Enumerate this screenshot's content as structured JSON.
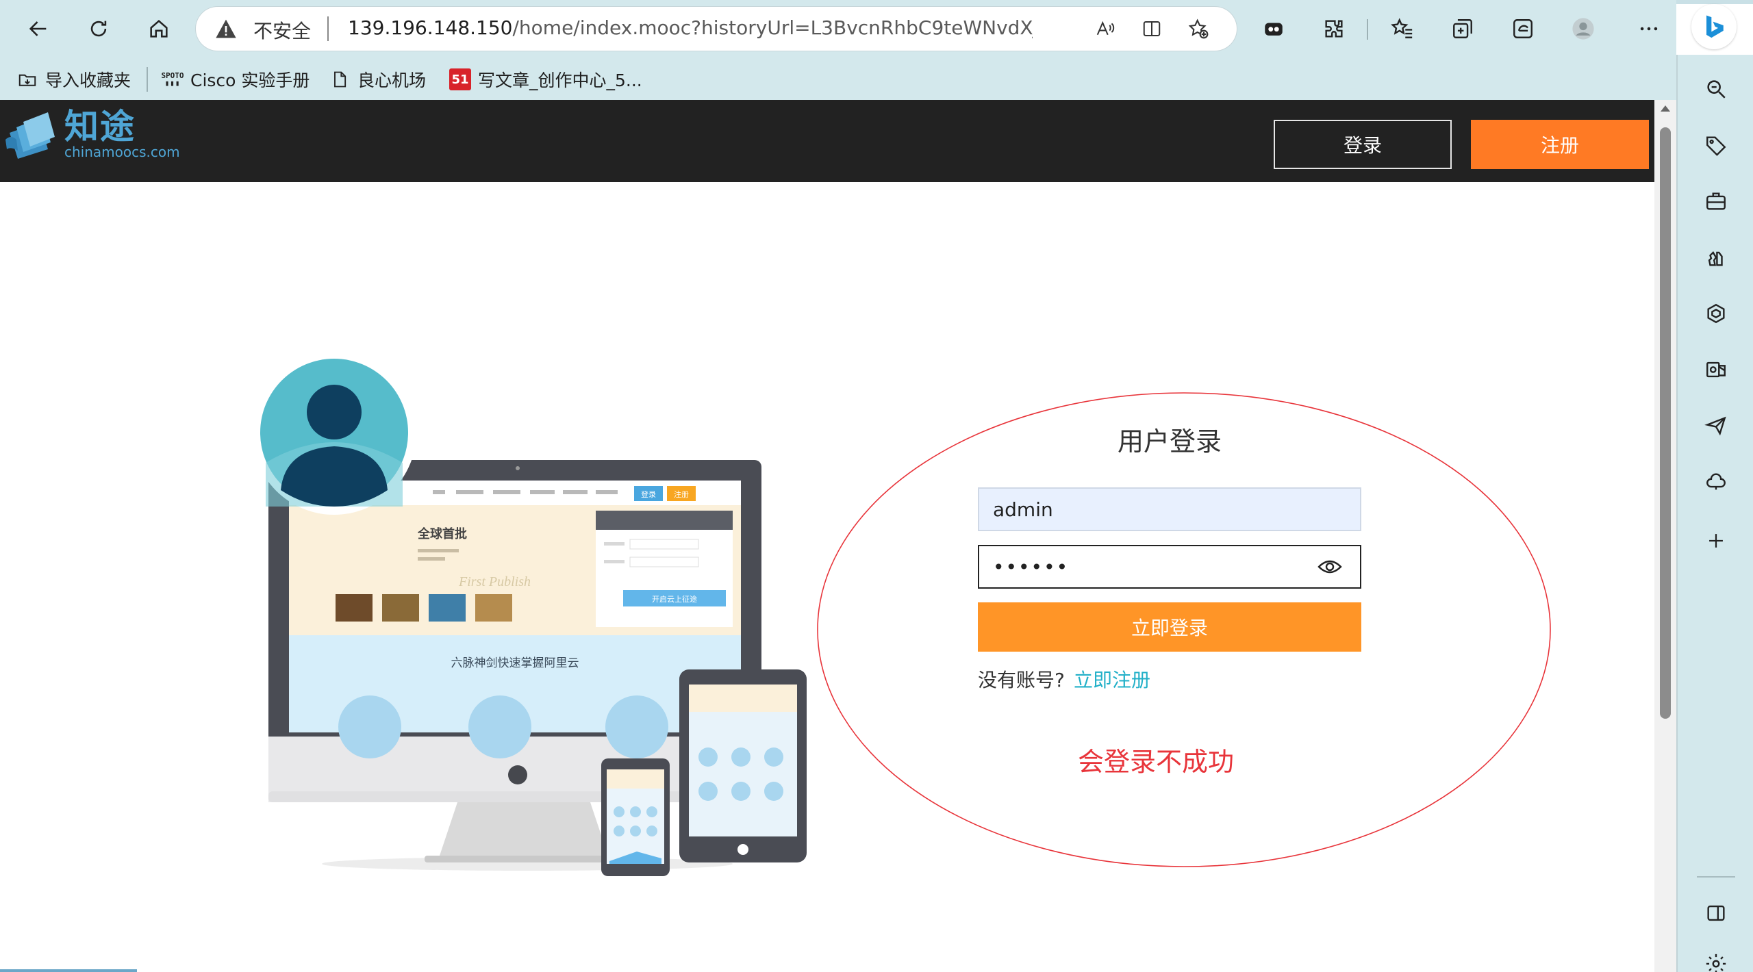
{
  "browser": {
    "address": {
      "security_label": "不安全",
      "url_host": "139.196.148.150",
      "url_rest": "/home/index.mooc?historyUrl=L3BvcnRhbC9teWNvdXJzZS9pbm..."
    },
    "bookmarks": [
      {
        "label": "导入收藏夹",
        "icon": "import-favorites-icon"
      },
      {
        "label": "Cisco 实验手册",
        "icon": "spoto-site-icon",
        "icon_text": "SPOTO"
      },
      {
        "label": "良心机场",
        "icon": "page-icon"
      },
      {
        "label": "写文章_创作中心_5...",
        "icon": "site-51-icon",
        "icon_text": "51"
      }
    ]
  },
  "site": {
    "logo_name": "知途",
    "logo_domain": "chinamoocs.com",
    "header_login": "登录",
    "header_register": "注册"
  },
  "login": {
    "title": "用户登录",
    "username_value": "admin",
    "password_masked": "••••••",
    "submit_label": "立即登录",
    "no_account_text": "没有账号?",
    "register_link": "立即注册"
  },
  "illustration": {
    "banner_text": "六脉神剑快速掌握阿里云",
    "headline_fragment": "全球首批",
    "nav_login": "登录",
    "nav_register": "注册",
    "form_button": "开启云上征途"
  },
  "annotation": {
    "text": "会登录不成功",
    "color": "#e8343a"
  },
  "colors": {
    "header_bg": "#222222",
    "register_orange": "#ff7a24",
    "login_button_orange": "#ff9527",
    "link_teal": "#22b0c8",
    "browser_chrome": "#d3e8ec"
  }
}
